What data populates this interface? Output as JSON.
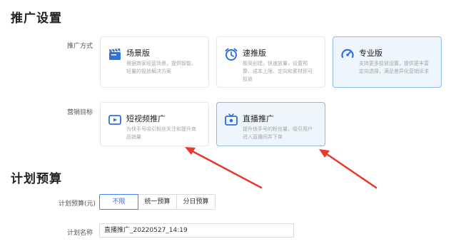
{
  "promotion_settings": {
    "title": "推广设置",
    "method_label": "推广方式",
    "goal_label": "营销目标",
    "methods": [
      {
        "name": "场景版",
        "desc": "根据商家经营场景，提供智能、\n轻量的投放解决方案",
        "icon": "clapperboard-icon",
        "selected": false
      },
      {
        "name": "速推版",
        "desc": "极简创建，快速放量，设置预\n算、成本上限、定向和素材即可\n投放",
        "icon": "alarm-clock-icon",
        "selected": false
      },
      {
        "name": "专业版",
        "desc": "支持更多投放设置，提供更丰富\n定向选择，满足差异化营销诉求",
        "icon": "gauge-icon",
        "selected": true
      }
    ],
    "goals": [
      {
        "name": "短视频推广",
        "desc": "为快手号吸引粉丝关注和提升商\n品销量",
        "icon": "video-play-icon",
        "selected": false
      },
      {
        "name": "直播推广",
        "desc": "提升快手号的粉丝量，吸引用户\n进入直播间并下单",
        "icon": "live-tv-icon",
        "selected": true
      }
    ]
  },
  "plan_budget": {
    "title": "计划预算",
    "budget_label": "计划预算(元)",
    "budget_options": [
      "不限",
      "统一预算",
      "分日预算"
    ],
    "budget_selected": "不限",
    "name_label": "计划名称",
    "name_value": "直播推广_20220527_14:19"
  },
  "colors": {
    "accent": "#3b82f6",
    "arrow": "#e8392c",
    "selected_bg": "#eef5fd"
  }
}
